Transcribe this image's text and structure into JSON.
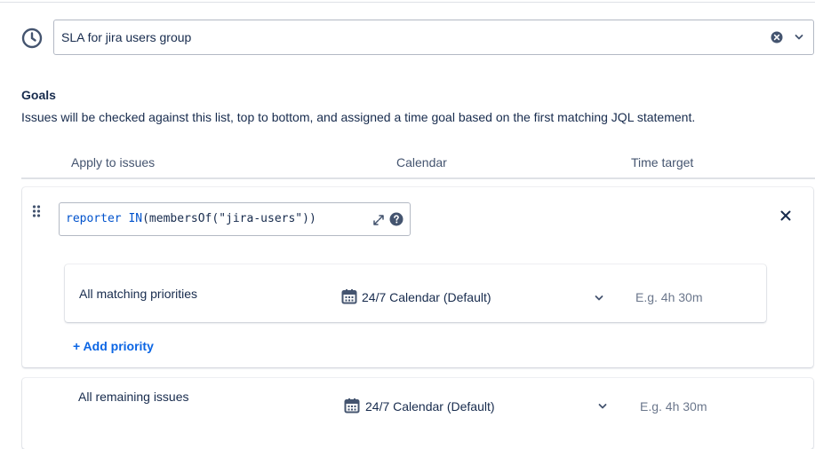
{
  "sla": {
    "name_value": "SLA for jira users group",
    "icons": {
      "leading": "clock-icon",
      "clear": "clear-icon",
      "dropdown": "chevron-down-icon"
    }
  },
  "goals": {
    "title": "Goals",
    "description": "Issues will be checked against this list, top to bottom, and assigned a time goal based on the first matching JQL statement.",
    "columns": {
      "apply": "Apply to issues",
      "calendar": "Calendar",
      "time_target": "Time target"
    },
    "goal_1": {
      "jql_keyword_1": "reporter",
      "jql_keyword_2": "IN",
      "jql_rest": "(membersOf(\"jira-users\"))",
      "priority_label": "All matching priorities",
      "calendar": "24/7 Calendar (Default)",
      "time_placeholder": "E.g. 4h 30m",
      "add_priority": "+ Add priority"
    },
    "remaining": {
      "label": "All remaining issues",
      "calendar": "24/7 Calendar (Default)",
      "time_placeholder": "E.g. 4h 30m"
    }
  },
  "colors": {
    "text": "#172b4d",
    "subtle": "#44546f",
    "link": "#0c66e4",
    "jql_keyword": "#0052cc",
    "border": "#b3b9c4"
  }
}
